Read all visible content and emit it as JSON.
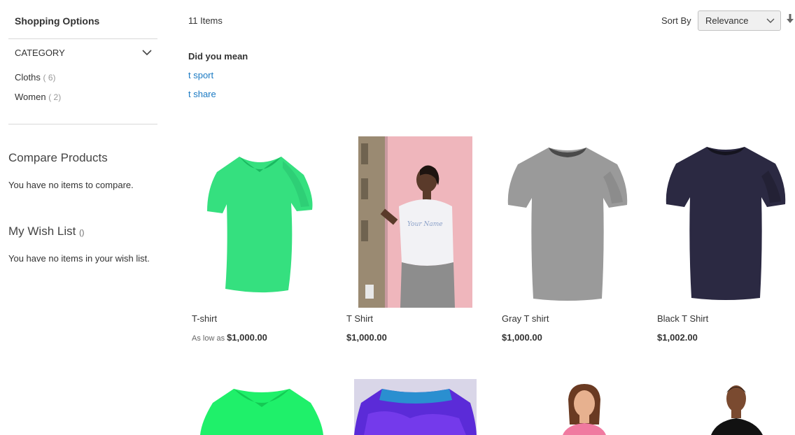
{
  "sidebar": {
    "shopping_options": "Shopping Options",
    "category_title": "CATEGORY",
    "filters": [
      {
        "label": "Cloths",
        "count": "( 6)"
      },
      {
        "label": "Women",
        "count": "( 2)"
      }
    ],
    "compare": {
      "title": "Compare Products",
      "empty": "You have no items to compare."
    },
    "wishlist": {
      "title": "My Wish List",
      "counter": "()",
      "empty": "You have no items in your wish list."
    }
  },
  "toolbar": {
    "items_count": "11 Items",
    "sort_label": "Sort By",
    "sort_value": "Relevance"
  },
  "suggestions": {
    "title": "Did you mean",
    "items": [
      "t sport",
      "t share"
    ]
  },
  "products": [
    {
      "name": "T-shirt",
      "price_prefix": "As low as",
      "price": "$1,000.00",
      "color": "#35e07f"
    },
    {
      "name": "T Shirt",
      "price_prefix": "",
      "price": "$1,000.00",
      "color": "#ffffff"
    },
    {
      "name": "Gray T shirt",
      "price_prefix": "",
      "price": "$1,000.00",
      "color": "#9a9a9a"
    },
    {
      "name": "Black T Shirt",
      "price_prefix": "",
      "price": "$1,002.00",
      "color": "#2b2942"
    }
  ],
  "colors": {
    "link": "#1979c3",
    "green_shirt": "#1ff06a",
    "purple_shirt": "#5b2bd8",
    "pink_top": "#f07aa0"
  }
}
